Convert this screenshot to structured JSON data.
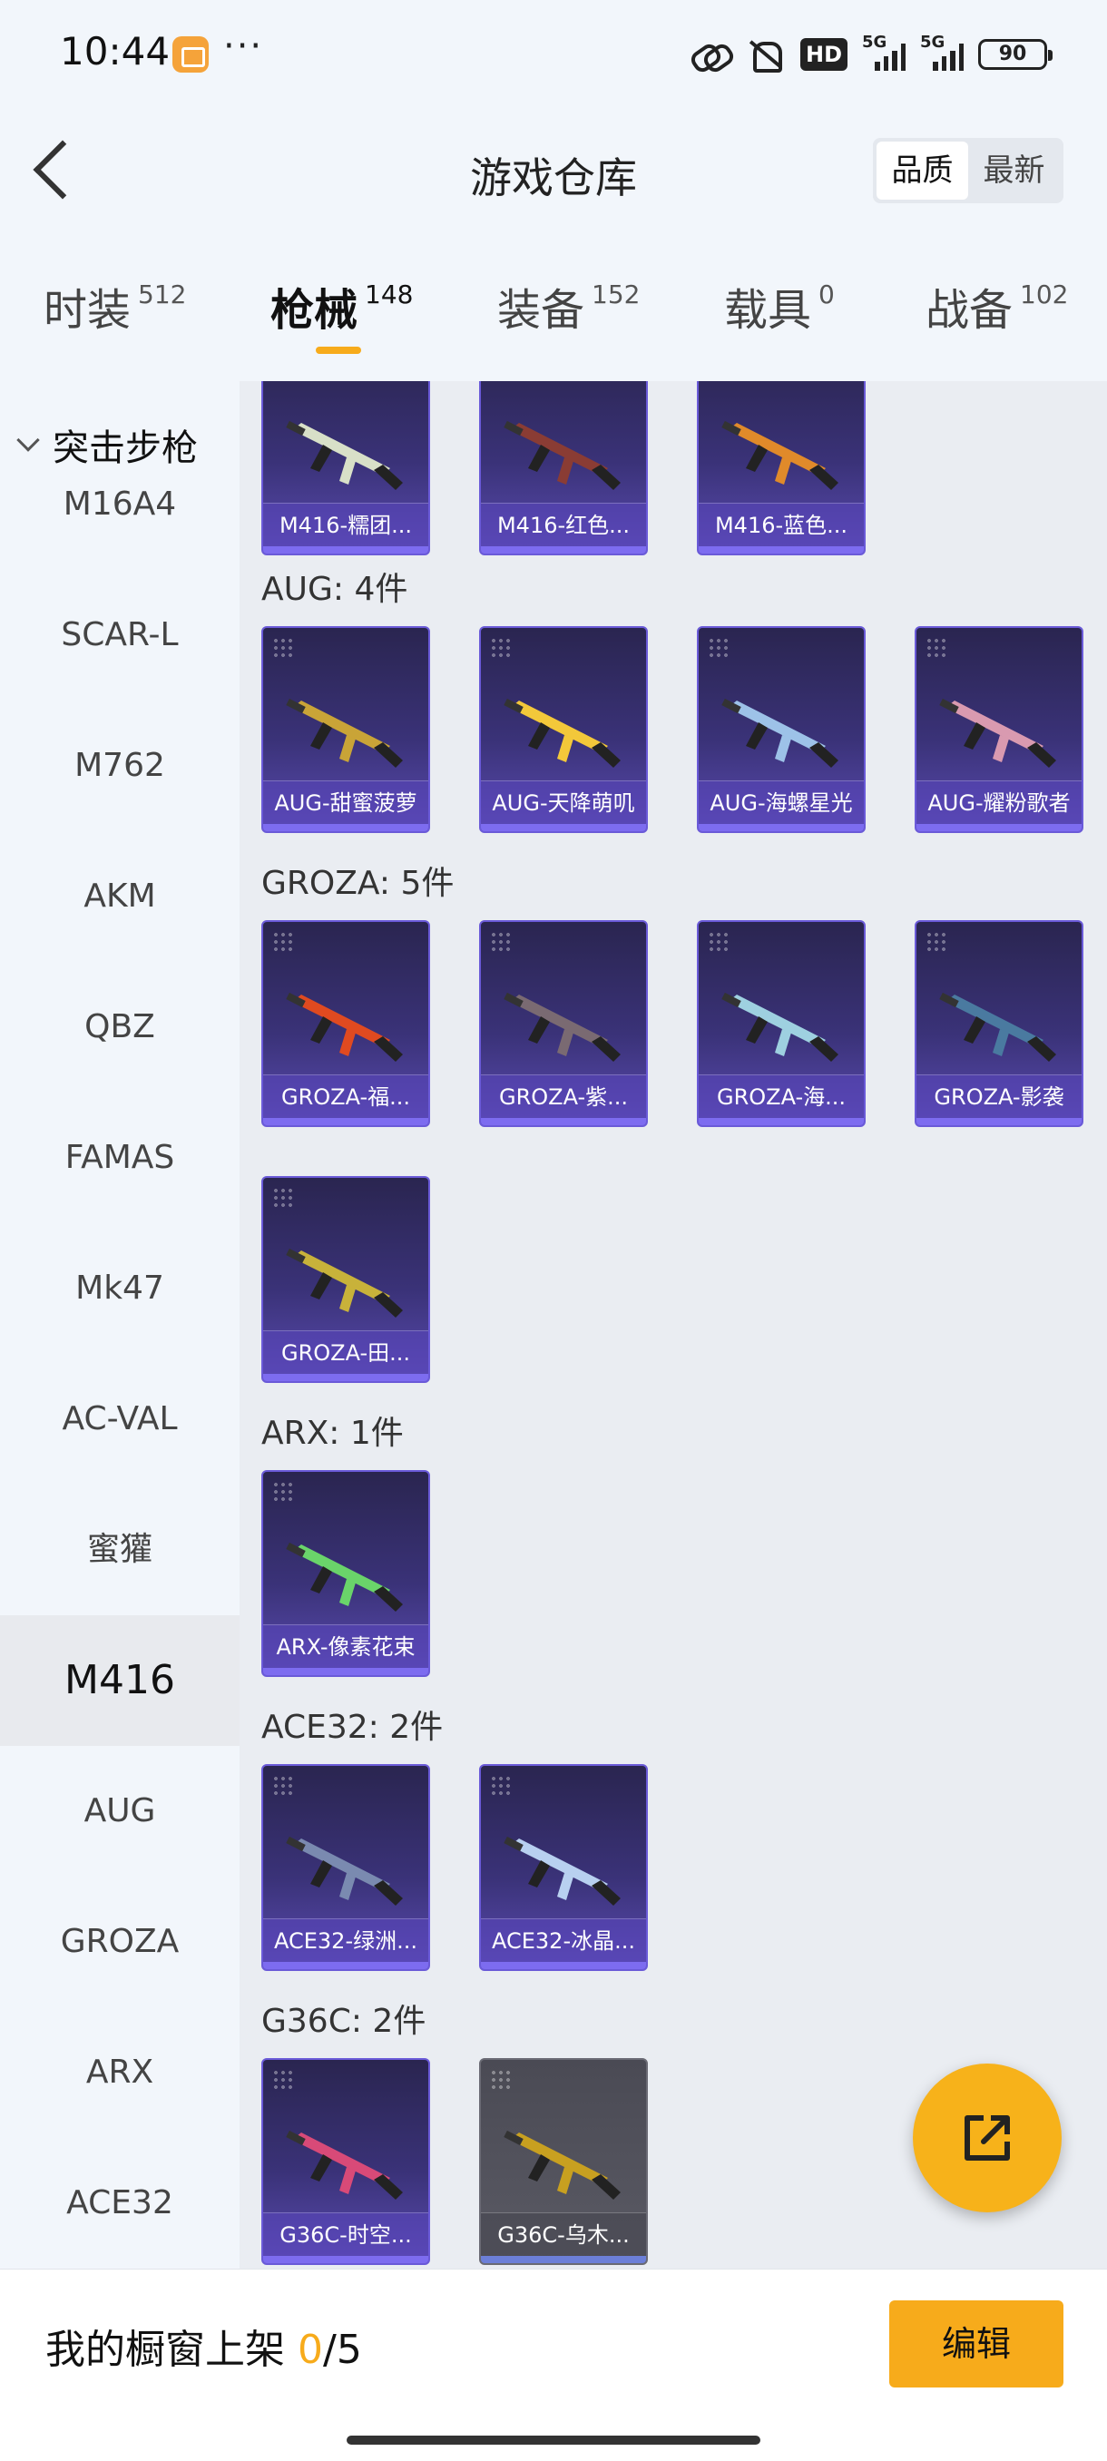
{
  "status_bar": {
    "time": "10:44",
    "dots": "···",
    "hd_label": "HD",
    "signal1_label": "5G",
    "signal2_label": "5G",
    "battery": "90"
  },
  "header": {
    "title": "游戏仓库",
    "sort_options": [
      "品质",
      "最新"
    ],
    "sort_active": "品质"
  },
  "tabs": [
    {
      "label": "时装",
      "count": "512"
    },
    {
      "label": "枪械",
      "count": "148",
      "active": true
    },
    {
      "label": "装备",
      "count": "152"
    },
    {
      "label": "载具",
      "count": "0"
    },
    {
      "label": "战备",
      "count": "102"
    }
  ],
  "sidebar": {
    "group_label": "突击步枪",
    "items": [
      "M16A4",
      "SCAR-L",
      "M762",
      "AKM",
      "QBZ",
      "FAMAS",
      "Mk47",
      "AC-VAL",
      "蜜獾",
      "M416",
      "AUG",
      "GROZA",
      "ARX",
      "ACE32"
    ],
    "active_item": "M416"
  },
  "sections": [
    {
      "title": "",
      "items": [
        "M416-糯团...",
        "M416-红色...",
        "M416-蓝色..."
      ]
    },
    {
      "title": "AUG: 4件",
      "items": [
        "AUG-甜蜜菠萝",
        "AUG-天降萌叽",
        "AUG-海螺星光",
        "AUG-耀粉歌者"
      ]
    },
    {
      "title": "GROZA: 5件",
      "items": [
        "GROZA-福...",
        "GROZA-紫...",
        "GROZA-海...",
        "GROZA-影袭",
        "GROZA-田..."
      ]
    },
    {
      "title": "ARX: 1件",
      "items": [
        "ARX-像素花束"
      ]
    },
    {
      "title": "ACE32: 2件",
      "items": [
        "ACE32-绿洲...",
        "ACE32-冰晶..."
      ]
    },
    {
      "title": "G36C: 2件",
      "items": [
        "G36C-时空...",
        "G36C-乌木..."
      ]
    }
  ],
  "gun_colors": [
    "#d8e0c8",
    "#8a3c34",
    "#e08a2a",
    "#c9a437",
    "#f3c83a",
    "#9dc2e8",
    "#d99ab0",
    "#e04a20",
    "#7a6a72",
    "#9ed0e0",
    "#4a7aa0",
    "#c8b23a",
    "#6ad46a",
    "#7a8ab0",
    "#b8d0f0",
    "#d84a78",
    "#c8a020"
  ],
  "bottom_bar": {
    "prefix": "我的橱窗上架 ",
    "current": "0",
    "suffix": "/5",
    "edit_label": "编辑"
  }
}
